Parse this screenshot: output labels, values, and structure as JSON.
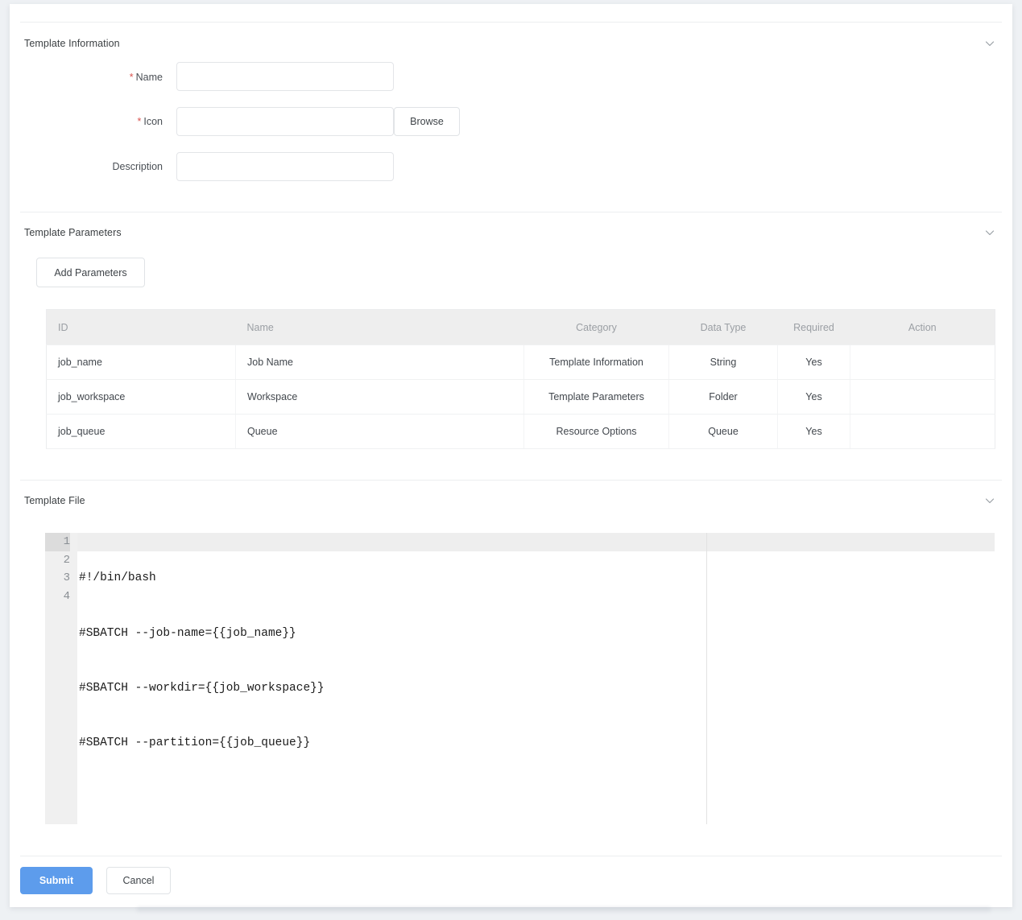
{
  "sections": {
    "template_information": {
      "title": "Template Information",
      "collapse_icon": "chevron-down-icon",
      "fields": {
        "name": {
          "label": "Name",
          "required_marker": "*",
          "value": "",
          "placeholder": ""
        },
        "icon": {
          "label": "Icon",
          "required_marker": "*",
          "value": "",
          "placeholder": "",
          "browse_label": "Browse"
        },
        "description": {
          "label": "Description",
          "required_marker": "",
          "value": "",
          "placeholder": ""
        }
      }
    },
    "template_parameters": {
      "title": "Template Parameters",
      "collapse_icon": "chevron-down-icon",
      "add_button_label": "Add Parameters",
      "table": {
        "columns": [
          "ID",
          "Name",
          "Category",
          "Data Type",
          "Required",
          "Action"
        ],
        "rows": [
          {
            "id": "job_name",
            "name": "Job Name",
            "category": "Template Information",
            "data_type": "String",
            "required": "Yes",
            "action": ""
          },
          {
            "id": "job_workspace",
            "name": "Workspace",
            "category": "Template Parameters",
            "data_type": "Folder",
            "required": "Yes",
            "action": ""
          },
          {
            "id": "job_queue",
            "name": "Queue",
            "category": "Resource Options",
            "data_type": "Queue",
            "required": "Yes",
            "action": ""
          }
        ]
      }
    },
    "template_file": {
      "title": "Template File",
      "collapse_icon": "chevron-down-icon",
      "editor": {
        "active_line": 1,
        "line_numbers": [
          "1",
          "2",
          "3",
          "4"
        ],
        "lines": [
          "#!/bin/bash",
          "#SBATCH --job-name={{job_name}}",
          "#SBATCH --workdir={{job_workspace}}",
          "#SBATCH --partition={{job_queue}}"
        ]
      }
    }
  },
  "footer": {
    "submit_label": "Submit",
    "cancel_label": "Cancel"
  },
  "colors": {
    "accent": "#5d9cec",
    "required_star": "#d9534f",
    "table_header_bg": "#eeeeee",
    "gutter_bg": "#f0f0f0",
    "active_line_bg": "#eeeeee",
    "page_bg": "#eef1f4",
    "card_bg": "#ffffff"
  }
}
